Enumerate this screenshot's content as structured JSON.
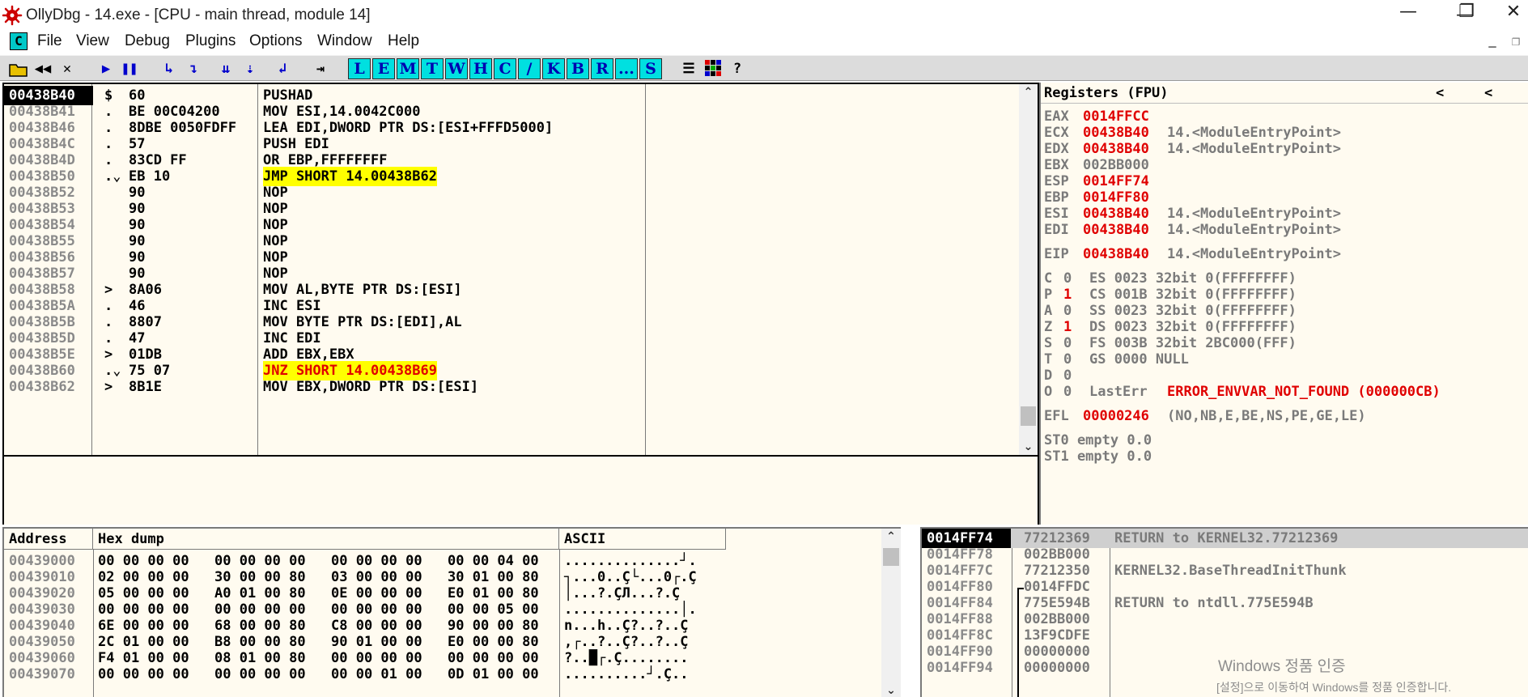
{
  "window": {
    "title": "OllyDbg - 14.exe - [CPU - main thread, module 14]",
    "minimize": "—",
    "restore": "❐",
    "close": "✕"
  },
  "menu": {
    "app_icon": "C",
    "items": [
      "File",
      "View",
      "Debug",
      "Plugins",
      "Options",
      "Window",
      "Help"
    ]
  },
  "toolbar": {
    "buttons": [
      "open-icon",
      "restart-icon",
      "close-icon",
      "run-icon",
      "pause-icon",
      "step-into-icon",
      "step-over-icon",
      "trace-into-icon",
      "trace-over-icon",
      "execute-till-return-icon",
      "goto-icon"
    ],
    "letters": [
      "L",
      "E",
      "M",
      "T",
      "W",
      "H",
      "C",
      "/",
      "K",
      "B",
      "R",
      "...",
      "S"
    ],
    "extra": [
      "list-icon",
      "grid-icon",
      "help-icon"
    ],
    "help_label": "?"
  },
  "cpu": {
    "rows": [
      {
        "addr": "00438B40",
        "mark": "$",
        "hex": "60",
        "asm": "PUSHAD",
        "hl": ""
      },
      {
        "addr": "00438B41",
        "mark": ".",
        "hex": "BE 00C04200",
        "asm": "MOV ESI,14.0042C000",
        "hl": ""
      },
      {
        "addr": "00438B46",
        "mark": ".",
        "hex": "8DBE 0050FDFF",
        "asm": "LEA EDI,DWORD PTR DS:[ESI+FFFD5000]",
        "hl": ""
      },
      {
        "addr": "00438B4C",
        "mark": ".",
        "hex": "57",
        "asm": "PUSH EDI",
        "hl": ""
      },
      {
        "addr": "00438B4D",
        "mark": ".",
        "hex": "83CD FF",
        "asm": "OR EBP,FFFFFFFF",
        "hl": ""
      },
      {
        "addr": "00438B50",
        "mark": ".⌄",
        "hex": "EB 10",
        "asm": "JMP SHORT 14.00438B62",
        "hl": "jmp"
      },
      {
        "addr": "00438B52",
        "mark": "",
        "hex": "90",
        "asm": "NOP",
        "hl": ""
      },
      {
        "addr": "00438B53",
        "mark": "",
        "hex": "90",
        "asm": "NOP",
        "hl": ""
      },
      {
        "addr": "00438B54",
        "mark": "",
        "hex": "90",
        "asm": "NOP",
        "hl": ""
      },
      {
        "addr": "00438B55",
        "mark": "",
        "hex": "90",
        "asm": "NOP",
        "hl": ""
      },
      {
        "addr": "00438B56",
        "mark": "",
        "hex": "90",
        "asm": "NOP",
        "hl": ""
      },
      {
        "addr": "00438B57",
        "mark": "",
        "hex": "90",
        "asm": "NOP",
        "hl": ""
      },
      {
        "addr": "00438B58",
        "mark": ">",
        "hex": "8A06",
        "asm": "MOV AL,BYTE PTR DS:[ESI]",
        "hl": ""
      },
      {
        "addr": "00438B5A",
        "mark": ".",
        "hex": "46",
        "asm": "INC ESI",
        "hl": ""
      },
      {
        "addr": "00438B5B",
        "mark": ".",
        "hex": "8807",
        "asm": "MOV BYTE PTR DS:[EDI],AL",
        "hl": ""
      },
      {
        "addr": "00438B5D",
        "mark": ".",
        "hex": "47",
        "asm": "INC EDI",
        "hl": ""
      },
      {
        "addr": "00438B5E",
        "mark": ">",
        "hex": "01DB",
        "asm": "ADD EBX,EBX",
        "hl": ""
      },
      {
        "addr": "00438B60",
        "mark": ".⌄",
        "hex": "75 07",
        "asm": "JNZ SHORT 14.00438B69",
        "hl": "jcc"
      },
      {
        "addr": "00438B62",
        "mark": ">",
        "hex": "8B1E",
        "asm": "MOV EBX,DWORD PTR DS:[ESI]",
        "hl": ""
      }
    ]
  },
  "registers": {
    "title": "Registers (FPU)",
    "nav_left": "<",
    "nav_left2": "<",
    "gp": [
      {
        "name": "EAX",
        "value": "0014FFCC",
        "comment": "",
        "changed": true
      },
      {
        "name": "ECX",
        "value": "00438B40",
        "comment": "14.<ModuleEntryPoint>",
        "changed": true
      },
      {
        "name": "EDX",
        "value": "00438B40",
        "comment": "14.<ModuleEntryPoint>",
        "changed": true
      },
      {
        "name": "EBX",
        "value": "002BB000",
        "comment": "",
        "changed": false
      },
      {
        "name": "ESP",
        "value": "0014FF74",
        "comment": "",
        "changed": true
      },
      {
        "name": "EBP",
        "value": "0014FF80",
        "comment": "",
        "changed": true
      },
      {
        "name": "ESI",
        "value": "00438B40",
        "comment": "14.<ModuleEntryPoint>",
        "changed": true
      },
      {
        "name": "EDI",
        "value": "00438B40",
        "comment": "14.<ModuleEntryPoint>",
        "changed": true
      }
    ],
    "eip": {
      "name": "EIP",
      "value": "00438B40",
      "comment": "14.<ModuleEntryPoint>"
    },
    "flags": [
      {
        "flag": "C",
        "val": "0",
        "seg": "ES 0023 32bit 0(FFFFFFFF)",
        "changed": false
      },
      {
        "flag": "P",
        "val": "1",
        "seg": "CS 001B 32bit 0(FFFFFFFF)",
        "changed": true
      },
      {
        "flag": "A",
        "val": "0",
        "seg": "SS 0023 32bit 0(FFFFFFFF)",
        "changed": false
      },
      {
        "flag": "Z",
        "val": "1",
        "seg": "DS 0023 32bit 0(FFFFFFFF)",
        "changed": true
      },
      {
        "flag": "S",
        "val": "0",
        "seg": "FS 003B 32bit 2BC000(FFF)",
        "changed": false
      },
      {
        "flag": "T",
        "val": "0",
        "seg": "GS 0000 NULL",
        "changed": false
      },
      {
        "flag": "D",
        "val": "0",
        "seg": "",
        "changed": false
      },
      {
        "flag": "O",
        "val": "0",
        "seg": "LastErr",
        "changed": false
      }
    ],
    "lasterr": "ERROR_ENVVAR_NOT_FOUND (000000CB)",
    "efl": {
      "name": "EFL",
      "value": "00000246",
      "comment": "(NO,NB,E,BE,NS,PE,GE,LE)"
    },
    "st0": "ST0 empty 0.0",
    "st1": "ST1 empty 0.0"
  },
  "dump": {
    "col_address": "Address",
    "col_hex": "Hex dump",
    "col_ascii": "ASCII",
    "rows": [
      {
        "addr": "00439000",
        "hex": [
          "00 00 00 00",
          "00 00 00 00",
          "00 00 00 00",
          "00 00 04 00"
        ],
        "ascii": "..............┘."
      },
      {
        "addr": "00439010",
        "hex": [
          "02 00 00 00",
          "30 00 00 80",
          "03 00 00 00",
          "30 01 00 80"
        ],
        "ascii": "┐...0..Ç└...0┌.Ç"
      },
      {
        "addr": "00439020",
        "hex": [
          "05 00 00 00",
          "A0 01 00 80",
          "0E 00 00 00",
          "E0 01 00 80"
        ],
        "ascii": "│...?.ÇЛ...?.Ç"
      },
      {
        "addr": "00439030",
        "hex": [
          "00 00 00 00",
          "00 00 00 00",
          "00 00 00 00",
          "00 00 05 00"
        ],
        "ascii": "..............│."
      },
      {
        "addr": "00439040",
        "hex": [
          "6E 00 00 00",
          "68 00 00 80",
          "C8 00 00 00",
          "90 00 00 80"
        ],
        "ascii": "n...h..Ç?..?..Ç"
      },
      {
        "addr": "00439050",
        "hex": [
          "2C 01 00 00",
          "B8 00 00 80",
          "90 01 00 00",
          "E0 00 00 80"
        ],
        "ascii": ",┌..?..Ç?..?..Ç"
      },
      {
        "addr": "00439060",
        "hex": [
          "F4 01 00 00",
          "08 01 00 80",
          "00 00 00 00",
          "00 00 00 00"
        ],
        "ascii": "?..█┌.Ç........"
      },
      {
        "addr": "00439070",
        "hex": [
          "00 00 00 00",
          "00 00 00 00",
          "00 00 01 00",
          "0D 01 00 00"
        ],
        "ascii": "..........┘.Ç.."
      }
    ]
  },
  "stack": {
    "rows": [
      {
        "addr": "0014FF74",
        "value": "77212369",
        "comment": "RETURN to KERNEL32.77212369",
        "sel": true
      },
      {
        "addr": "0014FF78",
        "value": "002BB000",
        "comment": "",
        "sel": false
      },
      {
        "addr": "0014FF7C",
        "value": "77212350",
        "comment": "KERNEL32.BaseThreadInitThunk",
        "sel": false
      },
      {
        "addr": "0014FF80",
        "value": "0014FFDC",
        "comment": "",
        "sel": false
      },
      {
        "addr": "0014FF84",
        "value": "775E594B",
        "comment": "RETURN to ntdll.775E594B",
        "sel": false
      },
      {
        "addr": "0014FF88",
        "value": "002BB000",
        "comment": "",
        "sel": false
      },
      {
        "addr": "0014FF8C",
        "value": "13F9CDFE",
        "comment": "",
        "sel": false
      },
      {
        "addr": "0014FF90",
        "value": "00000000",
        "comment": "",
        "sel": false
      },
      {
        "addr": "0014FF94",
        "value": "00000000",
        "comment": "",
        "sel": false
      }
    ]
  },
  "watermark": {
    "line1": "Windows 정품 인증",
    "line2": "[설정]으로 이동하여 Windows를 정품 인증합니다."
  }
}
